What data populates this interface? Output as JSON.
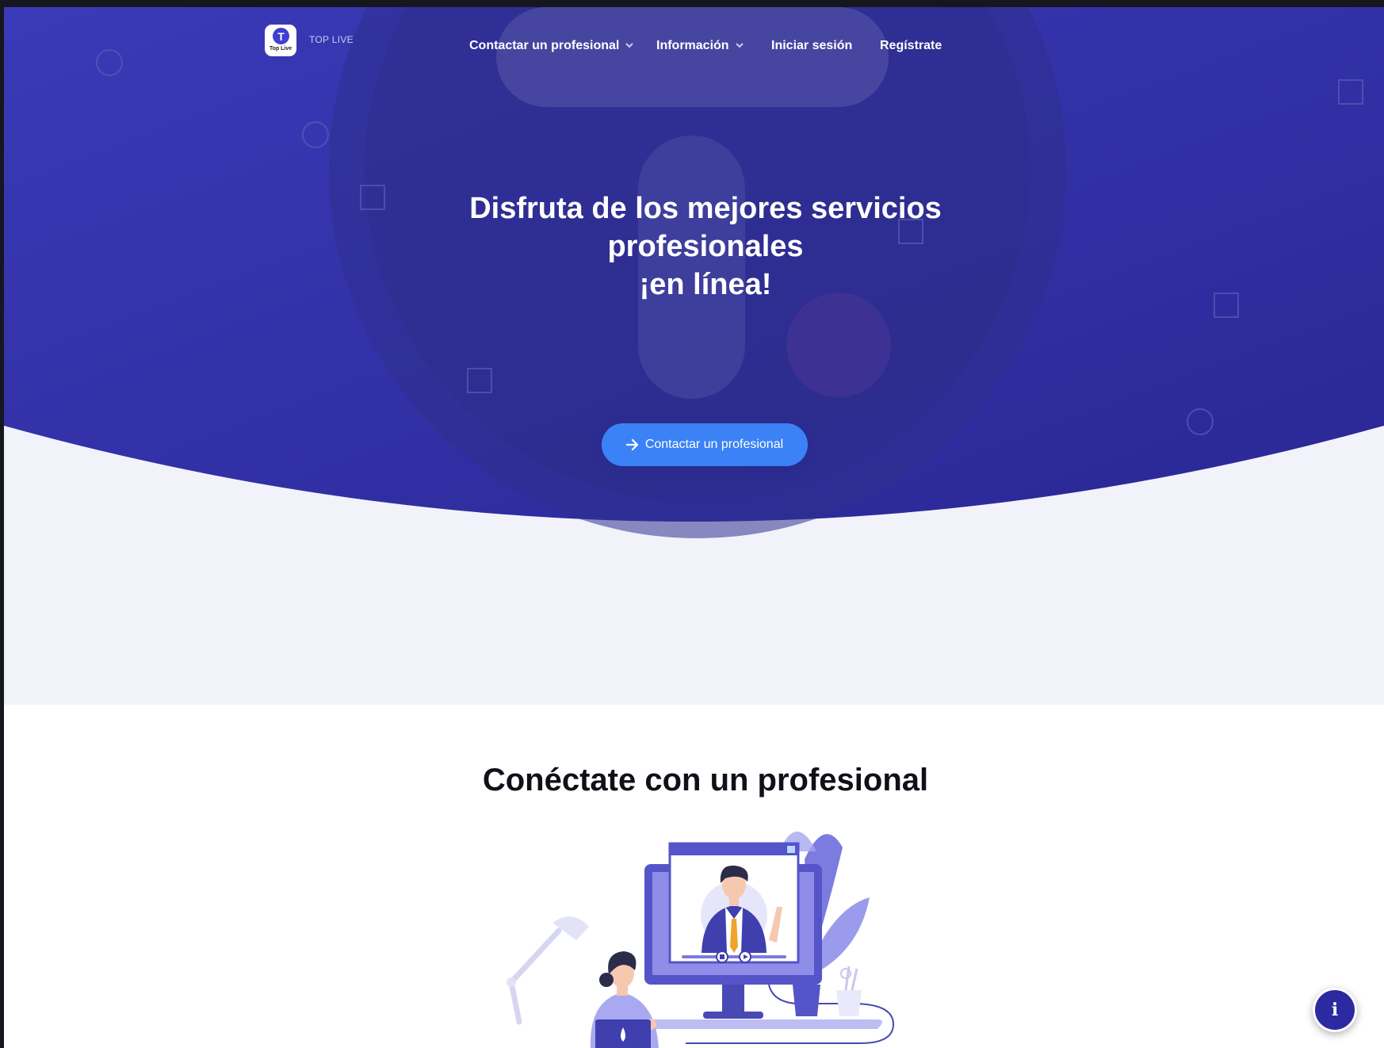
{
  "brand": {
    "logo_letter": "T",
    "logo_caption": "Top Live",
    "name": "TOP LIVE"
  },
  "nav": {
    "contact_label": "Contactar un profesional",
    "info_label": "Información",
    "login_label": "Iniciar sesión",
    "register_label": "Regístrate"
  },
  "hero": {
    "title_line1": "Disfruta de los mejores servicios",
    "title_line2": "profesionales",
    "title_line3": "¡en línea!",
    "cta_label": "Contactar un profesional",
    "cta_icon": "arrow-right-icon"
  },
  "connect": {
    "title": "Conéctate con un profesional"
  },
  "info_button": {
    "icon": "info-icon",
    "glyph": "i"
  },
  "colors": {
    "hero_start": "#3a3ab8",
    "hero_end": "#2a2794",
    "cta": "#3b82f6",
    "section_bg": "#f2f3fa",
    "info_button": "#2c2aa0"
  }
}
